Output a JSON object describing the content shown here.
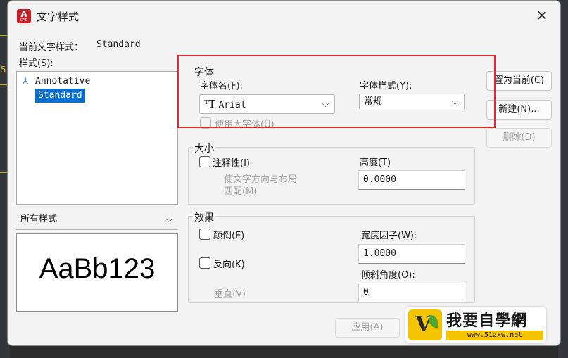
{
  "dialog": {
    "title": "文字样式",
    "app_icon_letter": "A",
    "app_icon_sub": "CAD",
    "close_glyph": "✕"
  },
  "canvas": {
    "left_number": "5"
  },
  "current_style": {
    "label": "当前文字样式：",
    "value": "Standard"
  },
  "styles": {
    "label": "样式(S):",
    "items": [
      {
        "label": "Annotative",
        "icon": "annotative-icon"
      },
      {
        "label": "Standard",
        "selected": true
      }
    ],
    "filter_value": "所有样式"
  },
  "preview": {
    "text": "AaBb123"
  },
  "font": {
    "group_title": "字体",
    "name_label": "字体名(F):",
    "name_value": "Arial",
    "name_icon": "truetype-font-icon",
    "style_label": "字体样式(Y):",
    "style_value": "常规",
    "bigfont_label": "使用大字体(U)",
    "bigfont_checked": false
  },
  "size": {
    "group_title": "大小",
    "annotative_label": "注释性(I)",
    "annotative_checked": false,
    "match_orientation_label_1": "使文字方向与布局",
    "match_orientation_label_2": "匹配(M)",
    "height_label": "高度(T)",
    "height_value": "0.0000"
  },
  "effects": {
    "group_title": "效果",
    "upside_down_label": "颠倒(E)",
    "upside_down_checked": false,
    "backwards_label": "反向(K)",
    "backwards_checked": false,
    "vertical_label": "垂直(V)",
    "width_factor_label": "宽度因子(W):",
    "width_factor_value": "1.0000",
    "oblique_label": "倾斜角度(O):",
    "oblique_value": "0"
  },
  "buttons": {
    "set_current": "置为当前(C)",
    "new": "新建(N)...",
    "delete": "删除(D)",
    "apply": "应用(A)"
  },
  "watermark": {
    "title": "我要自學網",
    "url": "www.51zxw.net",
    "badge_letter": "V"
  },
  "colors": {
    "highlight": "#e8262a",
    "selection": "#0b6fd0",
    "brand_yellow": "#f5c400"
  }
}
